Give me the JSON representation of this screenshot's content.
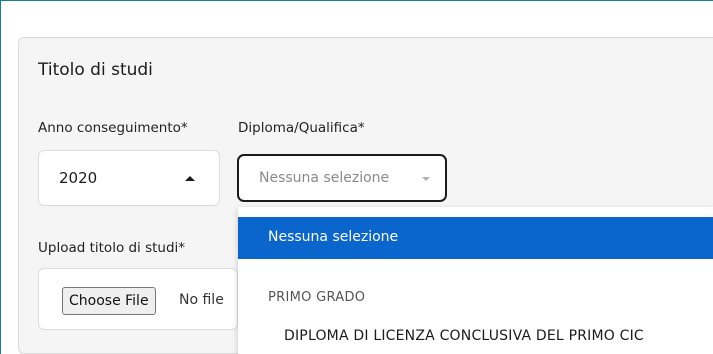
{
  "section": {
    "title": "Titolo di studi"
  },
  "anno": {
    "label": "Anno conseguimento*",
    "value": "2020"
  },
  "diploma": {
    "label": "Diploma/Qualifica*",
    "placeholder": "Nessuna selezione"
  },
  "upload": {
    "label": "Upload titolo di studi*",
    "button": "Choose File",
    "status": "No file"
  },
  "dropdown": {
    "selected": "Nessuna selezione",
    "group": "PRIMO GRADO",
    "items": [
      "DIPLOMA DI LICENZA CONCLUSIVA DEL PRIMO CIC"
    ]
  },
  "colors": {
    "highlight": "#0a66cc",
    "frame": "#1a7f8a"
  }
}
